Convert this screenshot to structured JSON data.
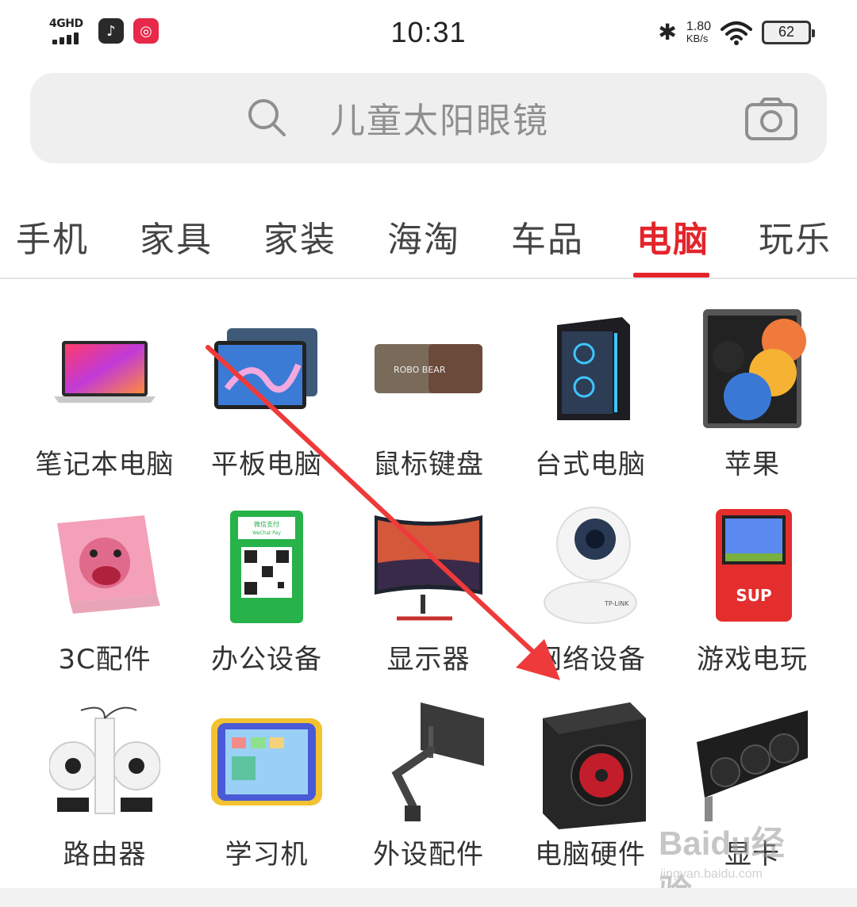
{
  "status_bar": {
    "network": "4GHD",
    "time": "10:31",
    "speed_value": "1.80",
    "speed_unit": "KB/s",
    "battery": "62"
  },
  "search": {
    "placeholder": "儿童太阳眼镜"
  },
  "tabs": [
    {
      "label": "手机"
    },
    {
      "label": "家具"
    },
    {
      "label": "家装"
    },
    {
      "label": "海淘"
    },
    {
      "label": "车品"
    },
    {
      "label": "电脑"
    },
    {
      "label": "玩乐"
    }
  ],
  "active_tab": "电脑",
  "categories": [
    {
      "label": "笔记本电脑"
    },
    {
      "label": "平板电脑"
    },
    {
      "label": "鼠标键盘"
    },
    {
      "label": "台式电脑"
    },
    {
      "label": "苹果"
    },
    {
      "label": "3C配件"
    },
    {
      "label": "办公设备"
    },
    {
      "label": "显示器"
    },
    {
      "label": "网络设备"
    },
    {
      "label": "游戏电玩"
    },
    {
      "label": "路由器"
    },
    {
      "label": "学习机"
    },
    {
      "label": "外设配件"
    },
    {
      "label": "电脑硬件"
    },
    {
      "label": "显卡"
    }
  ],
  "product_image_text": {
    "mousepad": "ROBO BEAR",
    "wechat_pay": "微信支付",
    "wechat_pay_en": "WeChat Pay",
    "monitor_brand": "TP-LINK",
    "game_sup": "SUP"
  },
  "watermark": {
    "logo": "Baidu经验",
    "url": "jingyan.baidu.com"
  },
  "colors": {
    "accent": "#e4242b",
    "arrow": "#ee3a3a"
  }
}
